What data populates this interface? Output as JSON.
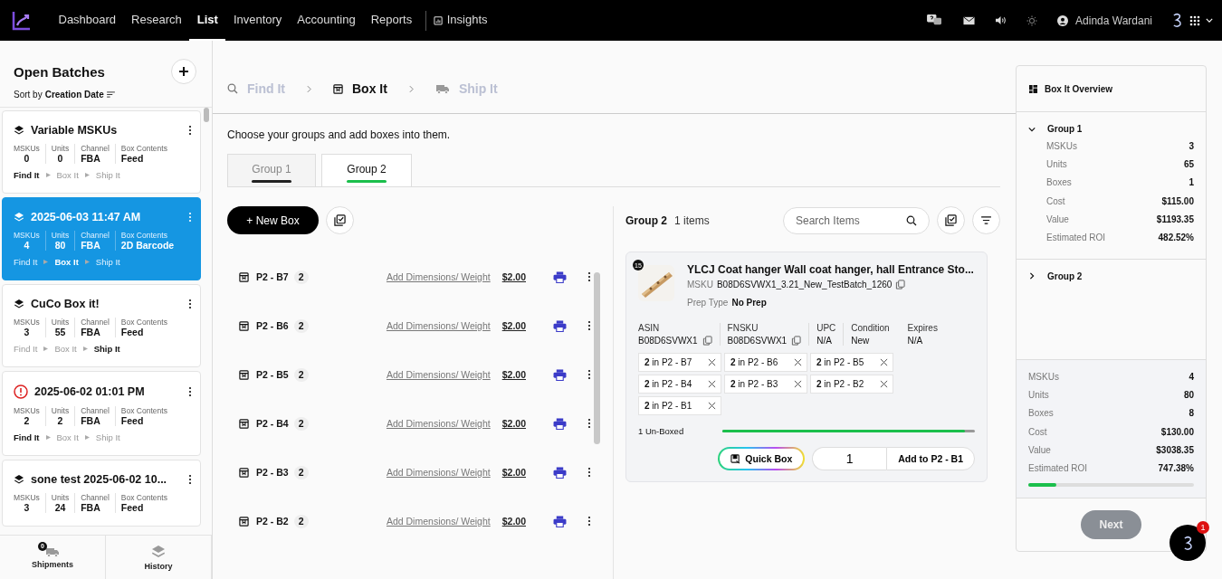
{
  "nav": {
    "items": [
      {
        "label": "Dashboard",
        "selected": false
      },
      {
        "label": "Research",
        "selected": false
      },
      {
        "label": "List",
        "selected": true
      },
      {
        "label": "Inventory",
        "selected": false
      },
      {
        "label": "Accounting",
        "selected": false
      },
      {
        "label": "Reports",
        "selected": false
      }
    ],
    "insights": "Insights",
    "user": "Adinda Wardani"
  },
  "sidebar": {
    "title": "Open Batches",
    "sort_label": "Sort by",
    "sort_value": "Creation Date",
    "batches": [
      {
        "title": "Variable MSKUs",
        "kind": "layers",
        "selected": false,
        "stats": [
          {
            "label": "MSKUs",
            "value": "0"
          },
          {
            "label": "Units",
            "value": "0"
          },
          {
            "label": "Channel",
            "value": "FBA"
          },
          {
            "label": "Box Contents",
            "value": "Feed"
          }
        ],
        "steps": [
          {
            "label": "Find It",
            "current": true
          },
          {
            "label": "Box It",
            "current": false
          },
          {
            "label": "Ship It",
            "current": false
          }
        ]
      },
      {
        "title": "2025-06-03 11:47 AM",
        "kind": "layers",
        "selected": true,
        "stats": [
          {
            "label": "MSKUs",
            "value": "4"
          },
          {
            "label": "Units",
            "value": "80"
          },
          {
            "label": "Channel",
            "value": "FBA"
          },
          {
            "label": "Box Contents",
            "value": "2D Barcode"
          }
        ],
        "steps": [
          {
            "label": "Find It",
            "current": false
          },
          {
            "label": "Box It",
            "current": true
          },
          {
            "label": "Ship It",
            "current": false
          }
        ]
      },
      {
        "title": "CuCo Box it!",
        "kind": "layers",
        "selected": false,
        "stats": [
          {
            "label": "MSKUs",
            "value": "3"
          },
          {
            "label": "Units",
            "value": "55"
          },
          {
            "label": "Channel",
            "value": "FBA"
          },
          {
            "label": "Box Contents",
            "value": "Feed"
          }
        ],
        "steps": [
          {
            "label": "Find It",
            "current": false
          },
          {
            "label": "Box It",
            "current": false
          },
          {
            "label": "Ship It",
            "current": true
          }
        ]
      },
      {
        "title": "2025-06-02 01:01 PM",
        "kind": "alert",
        "selected": false,
        "stats": [
          {
            "label": "MSKUs",
            "value": "2"
          },
          {
            "label": "Units",
            "value": "2"
          },
          {
            "label": "Channel",
            "value": "FBA"
          },
          {
            "label": "Box Contents",
            "value": "Feed"
          }
        ],
        "steps": [
          {
            "label": "Find It",
            "current": true
          },
          {
            "label": "Box It",
            "current": false
          },
          {
            "label": "Ship It",
            "current": false
          }
        ]
      },
      {
        "title": "sone test 2025-06-02 10...",
        "kind": "layers",
        "selected": false,
        "stats": [
          {
            "label": "MSKUs",
            "value": "3"
          },
          {
            "label": "Units",
            "value": "24"
          },
          {
            "label": "Channel",
            "value": "FBA"
          },
          {
            "label": "Box Contents",
            "value": "Feed"
          }
        ]
      }
    ],
    "footer": [
      {
        "label": "Shipments",
        "kind": "truck",
        "badge": "0"
      },
      {
        "label": "History",
        "kind": "layers"
      }
    ]
  },
  "stepper": [
    {
      "label": "Find It",
      "kind": "search",
      "selected": false
    },
    {
      "label": "Box It",
      "kind": "box",
      "selected": true
    },
    {
      "label": "Ship It",
      "kind": "truck",
      "selected": false
    }
  ],
  "instruction": "Choose your groups and add boxes into them.",
  "tabs": [
    {
      "label": "Group 1",
      "selected": false
    },
    {
      "label": "Group 2",
      "selected": true
    }
  ],
  "new_box": "+ New Box",
  "boxes": [
    {
      "name": "P2 - B7",
      "count": "2",
      "link": "Add Dimensions/ Weight",
      "price": "$2.00"
    },
    {
      "name": "P2 - B6",
      "count": "2",
      "link": "Add Dimensions/ Weight",
      "price": "$2.00"
    },
    {
      "name": "P2 - B5",
      "count": "2",
      "link": "Add Dimensions/ Weight",
      "price": "$2.00"
    },
    {
      "name": "P2 - B4",
      "count": "2",
      "link": "Add Dimensions/ Weight",
      "price": "$2.00"
    },
    {
      "name": "P2 - B3",
      "count": "2",
      "link": "Add Dimensions/ Weight",
      "price": "$2.00"
    },
    {
      "name": "P2 - B2",
      "count": "2",
      "link": "Add Dimensions/ Weight",
      "price": "$2.00"
    }
  ],
  "group_panel": {
    "title": "Group 2",
    "count": "1 items",
    "search_placeholder": "Search Items",
    "item": {
      "badge": "15",
      "title": "YLCJ Coat hanger Wall coat hanger, hall Entrance Sto...",
      "msku_label": "MSKU",
      "msku": "B08D6SVWX1_3.21_New_TestBatch_1260",
      "prep_label": "Prep Type",
      "prep": "No Prep",
      "fields": [
        {
          "label": "ASIN",
          "value": "B08D6SVWX1",
          "copy": true
        },
        {
          "label": "FNSKU",
          "value": "B08D6SVWX1",
          "copy": true
        },
        {
          "label": "UPC",
          "value": "N/A",
          "copy": false
        },
        {
          "label": "Condition",
          "value": "New",
          "copy": false
        },
        {
          "label": "Expires",
          "value": "N/A",
          "copy": false
        }
      ],
      "allocations": [
        {
          "count": "2",
          "label": "in P2 - B7"
        },
        {
          "count": "2",
          "label": "in P2 - B6"
        },
        {
          "count": "2",
          "label": "in P2 - B5"
        },
        {
          "count": "2",
          "label": "in P2 - B4"
        },
        {
          "count": "2",
          "label": "in P2 - B3"
        },
        {
          "count": "2",
          "label": "in P2 - B2"
        },
        {
          "count": "2",
          "label": "in P2 - B1"
        }
      ],
      "unboxed": "1 Un-Boxed",
      "level": 0.96,
      "quick_box": "Quick Box",
      "quantity": "1",
      "add_button": "Add to P2 - B1"
    }
  },
  "overview": {
    "title": "Box It Overview",
    "groups": [
      {
        "name": "Group 1",
        "expanded": true,
        "stats": [
          {
            "label": "MSKUs",
            "value": "3"
          },
          {
            "label": "Units",
            "value": "65"
          },
          {
            "label": "Boxes",
            "value": "1"
          },
          {
            "label": "Cost",
            "value": "$115.00"
          },
          {
            "label": "Value",
            "value": "$1193.35"
          },
          {
            "label": "Estimated ROI",
            "value": "482.52%"
          }
        ]
      },
      {
        "name": "Group 2",
        "expanded": false
      }
    ],
    "totals": [
      {
        "label": "MSKUs",
        "value": "4"
      },
      {
        "label": "Units",
        "value": "80"
      },
      {
        "label": "Boxes",
        "value": "8"
      },
      {
        "label": "Cost",
        "value": "$130.00"
      },
      {
        "label": "Value",
        "value": "$3038.35"
      },
      {
        "label": "Estimated ROI",
        "value": "747.38%"
      }
    ],
    "level": 0.17,
    "next": "Next",
    "next_disabled": true
  },
  "chat": {
    "badge": "1"
  }
}
